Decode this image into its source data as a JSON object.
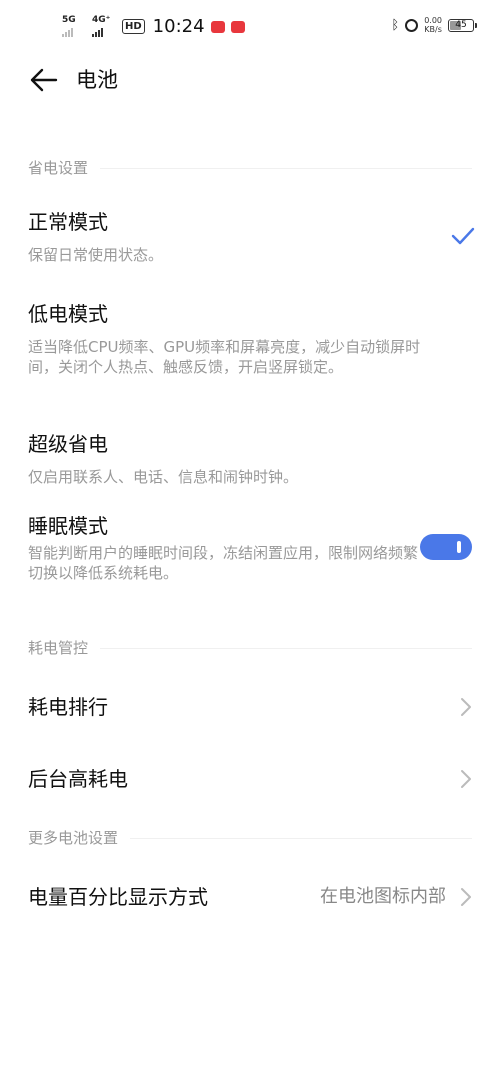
{
  "status_bar": {
    "sim1_label": "5G",
    "sim2_label": "4G⁺",
    "hd_label": "HD",
    "time": "10:24",
    "net_speed_value": "0.00",
    "net_speed_unit": "KB/s",
    "battery_level": "45"
  },
  "header": {
    "title": "电池"
  },
  "sections": {
    "power_saving": {
      "title": "省电设置"
    },
    "consumption": {
      "title": "耗电管控"
    },
    "more": {
      "title": "更多电池设置"
    }
  },
  "modes": {
    "normal": {
      "title": "正常模式",
      "desc": "保留日常使用状态。",
      "selected": true
    },
    "low_power": {
      "title": "低电模式",
      "desc": "适当降低CPU频率、GPU频率和屏幕亮度，减少自动锁屏时间，关闭个人热点、触感反馈，开启竖屏锁定。"
    },
    "super_saver": {
      "title": "超级省电",
      "desc": "仅启用联系人、电话、信息和闹钟时钟。"
    },
    "sleep": {
      "title": "睡眠模式",
      "desc": "智能判断用户的睡眠时间段，冻结闲置应用，限制网络频繁切换以降低系统耗电。",
      "enabled": true
    }
  },
  "consumption": {
    "ranking": {
      "title": "耗电排行"
    },
    "background": {
      "title": "后台高耗电"
    }
  },
  "more": {
    "percentage": {
      "title": "电量百分比显示方式",
      "value": "在电池图标内部"
    }
  },
  "colors": {
    "accent": "#4a78e8",
    "secondary_text": "#999999",
    "primary_text": "#111111"
  }
}
